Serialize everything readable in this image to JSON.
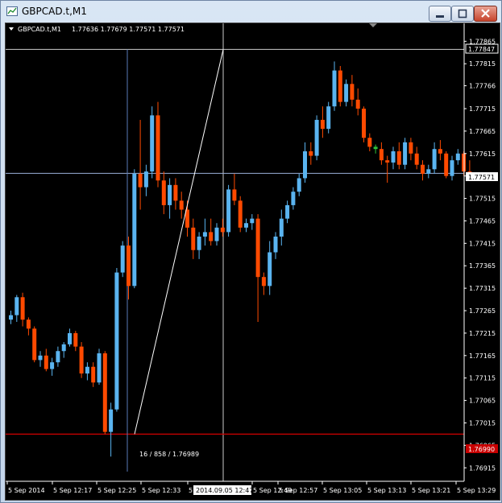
{
  "window": {
    "title": "GBPCAD.t,M1",
    "controls": [
      "minimize-icon",
      "maximize-icon",
      "close-icon"
    ]
  },
  "chart_header": {
    "symbol": "GBPCAD.t,M1",
    "ohlc": "1.77636 1.77679 1.77571 1.77571"
  },
  "crosshair": {
    "info": "16 / 858 / 1.76989",
    "time_label": "2014.09.05 12:47",
    "price_label": "1.77847"
  },
  "current_price_label": "1.77571",
  "lowline_price_label": "1.76990",
  "colors": {
    "bull": "#5ab4f0",
    "bear": "#ff4a00",
    "doji": "#2fc33a",
    "background": "#000000",
    "grid_text": "#ffffff",
    "low_line": "#c80000",
    "price_line": "#9ab0d8",
    "crosshair_line": "#ffffff",
    "trend_line": "#ffffff"
  },
  "chart_data": {
    "type": "candlestick",
    "y_ticks": [
      "1.77865",
      "1.77815",
      "1.77766",
      "1.77715",
      "1.77665",
      "1.77615",
      "1.77565",
      "1.77515",
      "1.77465",
      "1.77415",
      "1.77365",
      "1.77315",
      "1.77265",
      "1.77215",
      "1.77165",
      "1.77115",
      "1.77065",
      "1.77015",
      "1.76965",
      "1.76915"
    ],
    "x_ticks": [
      "5 Sep 2014",
      "5 Sep 12:17",
      "5 Sep 12:25",
      "5 Sep 12:33",
      "5",
      "5 Sep 12:49",
      "5 Sep 12:57",
      "5 Sep 13:05",
      "5 Sep 13:13",
      "5 Sep 13:21",
      "5 Sep 13:29"
    ],
    "ylim": [
      1.76885,
      1.77905
    ],
    "crosshair_price": 1.77847,
    "current_price": 1.77571,
    "low_price": 1.7699,
    "candles": [
      [
        1.77245,
        1.77265,
        1.77235,
        1.77255
      ],
      [
        1.77255,
        1.773,
        1.7724,
        1.77295
      ],
      [
        1.77295,
        1.77305,
        1.7723,
        1.77245
      ],
      [
        1.77245,
        1.7725,
        1.7721,
        1.77225
      ],
      [
        1.77225,
        1.7723,
        1.7715,
        1.77155
      ],
      [
        1.77155,
        1.77175,
        1.7714,
        1.77165
      ],
      [
        1.77165,
        1.7718,
        1.7713,
        1.77135
      ],
      [
        1.77135,
        1.7716,
        1.7712,
        1.7715
      ],
      [
        1.7715,
        1.77185,
        1.7714,
        1.77175
      ],
      [
        1.77175,
        1.77195,
        1.7716,
        1.7719
      ],
      [
        1.7719,
        1.77225,
        1.77185,
        1.77215
      ],
      [
        1.77215,
        1.7722,
        1.77175,
        1.77185
      ],
      [
        1.77185,
        1.77195,
        1.77115,
        1.77125
      ],
      [
        1.77125,
        1.7715,
        1.7711,
        1.7714
      ],
      [
        1.7714,
        1.7715,
        1.77095,
        1.77105
      ],
      [
        1.77105,
        1.7718,
        1.771,
        1.7717
      ],
      [
        1.7717,
        1.77175,
        1.7699,
        1.76995
      ],
      [
        1.76995,
        1.7706,
        1.7694,
        1.77045
      ],
      [
        1.77045,
        1.7736,
        1.7704,
        1.7735
      ],
      [
        1.7735,
        1.7742,
        1.7734,
        1.7741
      ],
      [
        1.7741,
        1.7743,
        1.7729,
        1.7732
      ],
      [
        1.7732,
        1.7758,
        1.77315,
        1.7757
      ],
      [
        1.7757,
        1.7769,
        1.7749,
        1.7754
      ],
      [
        1.7754,
        1.7759,
        1.7752,
        1.77575
      ],
      [
        1.77575,
        1.7772,
        1.7756,
        1.777
      ],
      [
        1.777,
        1.7773,
        1.7754,
        1.77555
      ],
      [
        1.77555,
        1.77575,
        1.7748,
        1.775
      ],
      [
        1.775,
        1.7756,
        1.7747,
        1.77545
      ],
      [
        1.77545,
        1.7756,
        1.7749,
        1.7751
      ],
      [
        1.7751,
        1.7753,
        1.7747,
        1.7749
      ],
      [
        1.7749,
        1.7751,
        1.7743,
        1.7745
      ],
      [
        1.7745,
        1.7747,
        1.7738,
        1.774
      ],
      [
        1.774,
        1.7744,
        1.7738,
        1.7743
      ],
      [
        1.7743,
        1.7747,
        1.7741,
        1.7744
      ],
      [
        1.7744,
        1.7747,
        1.7741,
        1.7742
      ],
      [
        1.7742,
        1.7746,
        1.7741,
        1.7745
      ],
      [
        1.7745,
        1.7747,
        1.7743,
        1.7744
      ],
      [
        1.7744,
        1.77545,
        1.7743,
        1.77535
      ],
      [
        1.77535,
        1.7757,
        1.775,
        1.7751
      ],
      [
        1.7751,
        1.7752,
        1.7744,
        1.7745
      ],
      [
        1.7745,
        1.7747,
        1.7744,
        1.7746
      ],
      [
        1.7746,
        1.7748,
        1.77445,
        1.7747
      ],
      [
        1.7747,
        1.7748,
        1.7724,
        1.7734
      ],
      [
        1.7734,
        1.7735,
        1.773,
        1.7732
      ],
      [
        1.7732,
        1.7742,
        1.773,
        1.77395
      ],
      [
        1.77395,
        1.7744,
        1.7738,
        1.7743
      ],
      [
        1.7743,
        1.7749,
        1.7741,
        1.7747
      ],
      [
        1.7747,
        1.7751,
        1.7746,
        1.775
      ],
      [
        1.775,
        1.7754,
        1.7749,
        1.7753
      ],
      [
        1.7753,
        1.7757,
        1.7752,
        1.7756
      ],
      [
        1.7756,
        1.7764,
        1.7755,
        1.7762
      ],
      [
        1.7762,
        1.7764,
        1.7759,
        1.7761
      ],
      [
        1.7761,
        1.777,
        1.776,
        1.7769
      ],
      [
        1.7769,
        1.7772,
        1.7765,
        1.7767
      ],
      [
        1.7767,
        1.7773,
        1.7766,
        1.7772
      ],
      [
        1.7772,
        1.7782,
        1.7771,
        1.778
      ],
      [
        1.778,
        1.7781,
        1.7772,
        1.7773
      ],
      [
        1.7773,
        1.7778,
        1.7772,
        1.7777
      ],
      [
        1.7777,
        1.7779,
        1.7772,
        1.77735
      ],
      [
        1.77735,
        1.7776,
        1.777,
        1.77715
      ],
      [
        1.77715,
        1.7772,
        1.7764,
        1.7765
      ],
      [
        1.7765,
        1.7766,
        1.7762,
        1.7763
      ],
      [
        1.7763,
        1.77635,
        1.77615,
        1.77625
      ],
      [
        1.77625,
        1.7764,
        1.7759,
        1.776
      ],
      [
        1.776,
        1.7761,
        1.7755,
        1.77595
      ],
      [
        1.77595,
        1.7763,
        1.7758,
        1.7762
      ],
      [
        1.7762,
        1.7764,
        1.7758,
        1.7759
      ],
      [
        1.7759,
        1.7765,
        1.7758,
        1.7764
      ],
      [
        1.7764,
        1.7765,
        1.776,
        1.77615
      ],
      [
        1.77615,
        1.7763,
        1.7758,
        1.7759
      ],
      [
        1.7759,
        1.776,
        1.77555,
        1.7757
      ],
      [
        1.7757,
        1.7759,
        1.7756,
        1.7758
      ],
      [
        1.7758,
        1.7764,
        1.7757,
        1.77625
      ],
      [
        1.77625,
        1.77645,
        1.776,
        1.77615
      ],
      [
        1.77615,
        1.7762,
        1.7756,
        1.77565
      ],
      [
        1.77565,
        1.7761,
        1.77555,
        1.776
      ],
      [
        1.776,
        1.77625,
        1.7759,
        1.77615
      ],
      [
        1.77615,
        1.7762,
        1.77565,
        1.77575
      ],
      [
        1.77575,
        1.776,
        1.7756,
        1.77571
      ]
    ]
  }
}
